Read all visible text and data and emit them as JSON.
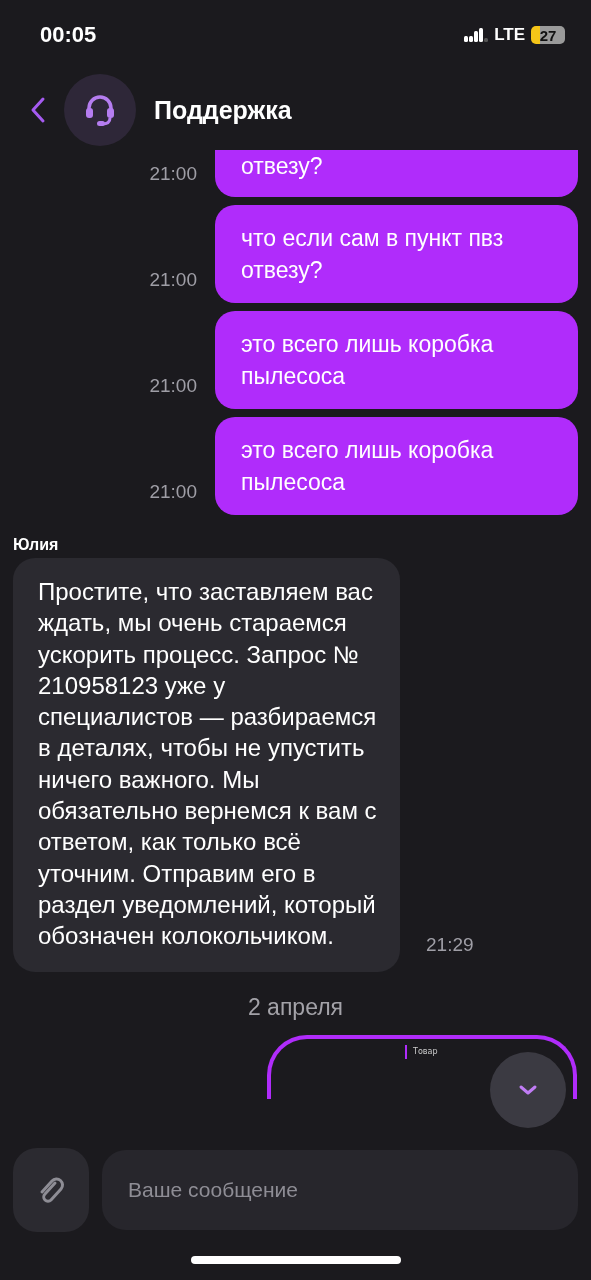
{
  "status_bar": {
    "time": "00:05",
    "network": "LTE",
    "battery": "27"
  },
  "header": {
    "title": "Поддержка"
  },
  "messages": [
    {
      "kind": "outgoing",
      "text": "отвезу?",
      "time": "21:00",
      "clipped": true
    },
    {
      "kind": "outgoing",
      "text": "что если сам в пункт пвз отвезу?",
      "time": "21:00",
      "clipped": false
    },
    {
      "kind": "outgoing",
      "text": "это всего лишь коробка пылесоса",
      "time": "21:00",
      "clipped": false
    },
    {
      "kind": "outgoing",
      "text": "это всего лишь коробка пылесоса",
      "time": "21:00",
      "clipped": false
    },
    {
      "kind": "incoming",
      "author": "Юлия",
      "text": "Простите, что заставляем вас ждать, мы очень стараемся ускорить процесс. Запрос № 210958123 уже у специалистов — разбираемся в деталях, чтобы не упустить ничего важного. Мы обязательно вернемся к вам с ответом, как только всё уточним. Отправим его в раздел уведомлений, который обозначен колокольчиком.",
      "time": "21:29"
    },
    {
      "kind": "date",
      "text": "2 апреля"
    },
    {
      "kind": "card",
      "text": "Товар"
    }
  ],
  "composer": {
    "placeholder": "Ваше сообщение"
  }
}
